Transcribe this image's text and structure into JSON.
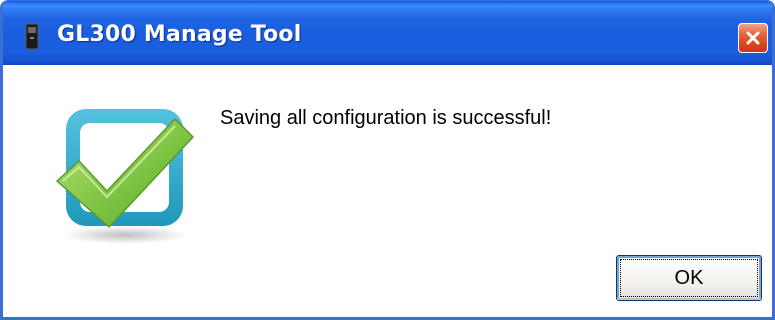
{
  "window": {
    "title": "GL300 Manage Tool",
    "app_icon": "device-icon",
    "close_icon": "close-icon"
  },
  "dialog": {
    "message": "Saving all configuration is successful!",
    "status_icon": "success-checkmark-icon",
    "ok_label": "OK"
  },
  "colors": {
    "titlebar": "#1b5fe0",
    "close_button": "#d8481f",
    "checkbox_frame": "#2aa8c8",
    "checkmark": "#7ec443"
  }
}
